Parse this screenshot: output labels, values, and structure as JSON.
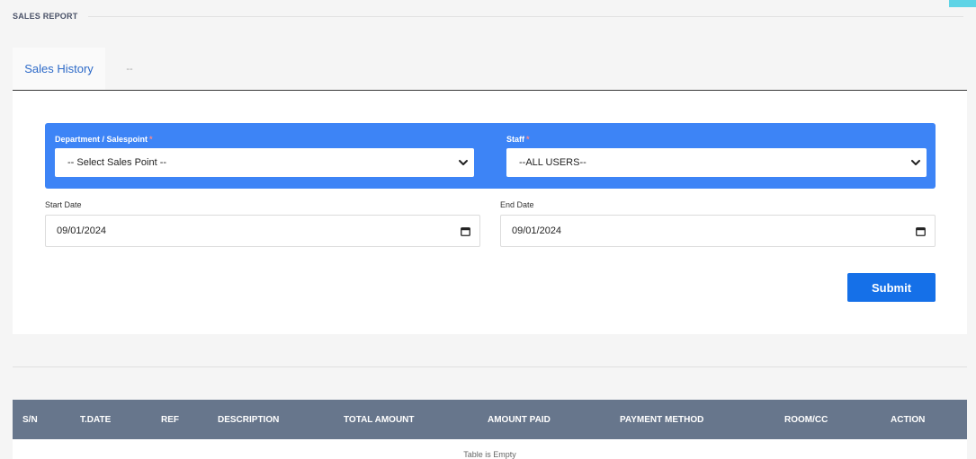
{
  "page": {
    "title": "SALES REPORT"
  },
  "tabs": [
    {
      "label": "Sales History",
      "active": true
    },
    {
      "label": "--",
      "active": false
    }
  ],
  "filters": {
    "department": {
      "label": "Department / Salespoint",
      "required_mark": "*",
      "value": "-- Select Sales Point --"
    },
    "staff": {
      "label": "Staff",
      "required_mark": "*",
      "value": "--ALL USERS--"
    },
    "start_date": {
      "label": "Start Date",
      "value": "09/01/2024"
    },
    "end_date": {
      "label": "End Date",
      "value": "09/01/2024"
    },
    "submit_label": "Submit"
  },
  "table": {
    "columns": [
      "S/N",
      "T.DATE",
      "REF",
      "DESCRIPTION",
      "TOTAL AMOUNT",
      "AMOUNT PAID",
      "PAYMENT METHOD",
      "ROOM/CC",
      "ACTION"
    ],
    "empty_message": "Table is Empty"
  },
  "colors": {
    "accent_blue": "#3d84f6",
    "button_blue": "#1570e8",
    "table_header": "#67768c",
    "tab_active_text": "#2d6ac8",
    "corner_accent": "#5fd4e6"
  },
  "icons": {
    "select_chevron": "chevron-down-icon",
    "date_picker": "calendar-icon"
  }
}
